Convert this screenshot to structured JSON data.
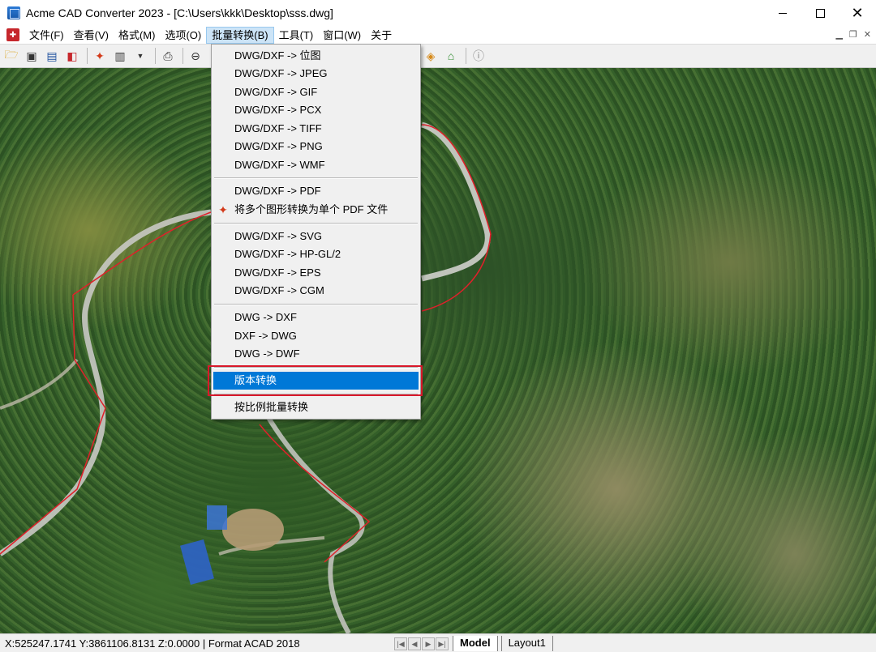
{
  "window": {
    "title": "Acme CAD Converter 2023 - [C:\\Users\\kkk\\Desktop\\sss.dwg]"
  },
  "menubar": {
    "items": [
      "文件(F)",
      "查看(V)",
      "格式(M)",
      "选项(O)",
      "批量转换(B)",
      "工具(T)",
      "窗口(W)",
      "关于"
    ],
    "active_index": 4
  },
  "dropdown": {
    "groups": [
      [
        "DWG/DXF -> 位图",
        "DWG/DXF -> JPEG",
        "DWG/DXF -> GIF",
        "DWG/DXF -> PCX",
        "DWG/DXF -> TIFF",
        "DWG/DXF -> PNG",
        "DWG/DXF -> WMF"
      ],
      [
        "DWG/DXF -> PDF",
        "将多个图形转换为单个 PDF 文件"
      ],
      [
        "DWG/DXF -> SVG",
        "DWG/DXF -> HP-GL/2",
        "DWG/DXF -> EPS",
        "DWG/DXF -> CGM"
      ],
      [
        "DWG -> DXF",
        "DXF -> DWG",
        "DWG -> DWF"
      ],
      [
        "版本转换"
      ],
      [
        "按比例批量转换"
      ]
    ],
    "highlighted": "版本转换"
  },
  "statusbar": {
    "coords": "X:525247.1741 Y:3861106.8131 Z:0.0000 | Format ACAD 2018",
    "tabs": [
      "Model",
      "Layout1"
    ],
    "active_tab": "Model"
  },
  "colors": {
    "highlight": "#0078d7",
    "frame": "#d9182a",
    "boundary": "#e0202a"
  }
}
